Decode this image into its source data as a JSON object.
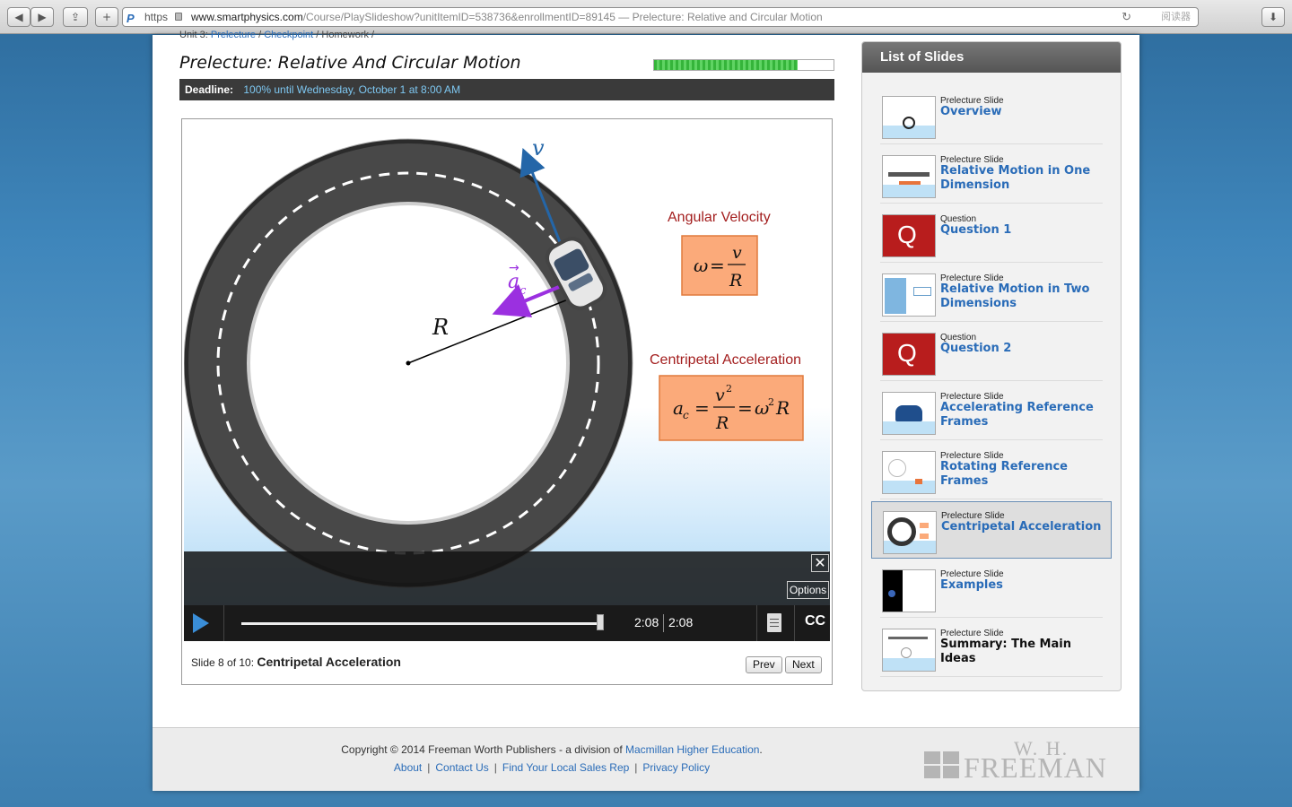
{
  "browser": {
    "protocol": "https",
    "url_host": "www.smartphysics.com",
    "url_path": "/Course/PlaySlideshow?unitItemID=538736&enrollmentID=89145",
    "page_title": "— Prelecture: Relative and Circular Motion",
    "reader_label": "阅读器"
  },
  "breadcrumb": {
    "unit": "Unit 3:",
    "prelecture": "Prelecture",
    "sep1": "/",
    "checkpoint": "Checkpoint",
    "sep2": "/",
    "homework": "Homework /"
  },
  "header": {
    "title": "Prelecture: Relative And Circular Motion",
    "progress": 0.8,
    "deadline_label": "Deadline:",
    "deadline_value": "100% until Wednesday, October 1 at 8:00 AM"
  },
  "slide": {
    "labels": {
      "v": "v",
      "R": "R",
      "ac": "a",
      "ac_sub": "c",
      "angular_velocity": "Angular Velocity",
      "centripetal_acceleration": "Centripetal Acceleration"
    },
    "player": {
      "close_label": "✕",
      "options_label": "Options",
      "current_time": "2:08",
      "total_time": "2:08",
      "progress": 1.0,
      "cc_label": "CC"
    },
    "caption_prefix": "Slide 8 of 10:",
    "caption_title": "Centripetal Acceleration",
    "prev_label": "Prev",
    "next_label": "Next"
  },
  "sidebar": {
    "heading": "List of Slides",
    "items": [
      {
        "type": "Prelecture Slide",
        "title": "Overview",
        "thumb": "overview"
      },
      {
        "type": "Prelecture Slide",
        "title": "Relative Motion in One Dimension",
        "thumb": "boat"
      },
      {
        "type": "Question",
        "title": "Question 1",
        "thumb": "question"
      },
      {
        "type": "Prelecture Slide",
        "title": "Relative Motion in Two Dimensions",
        "thumb": "river"
      },
      {
        "type": "Question",
        "title": "Question 2",
        "thumb": "question"
      },
      {
        "type": "Prelecture Slide",
        "title": "Accelerating Reference Frames",
        "thumb": "car"
      },
      {
        "type": "Prelecture Slide",
        "title": "Rotating Reference Frames",
        "thumb": "rotating"
      },
      {
        "type": "Prelecture Slide",
        "title": "Centripetal Acceleration",
        "thumb": "ring",
        "active": true
      },
      {
        "type": "Prelecture Slide",
        "title": "Examples",
        "thumb": "examples"
      },
      {
        "type": "Prelecture Slide",
        "title": "Summary: The Main Ideas",
        "thumb": "summary"
      }
    ]
  },
  "footer": {
    "copyright_text": "Copyright © 2014 Freeman Worth Publishers - a division of",
    "copyright_link": "Macmillan Higher Education",
    "copyright_end": ".",
    "links": [
      "About",
      "Contact Us",
      "Find Your Local Sales Rep",
      "Privacy Policy"
    ],
    "logo_top": "W. H.",
    "logo_name": "FREEMAN"
  },
  "colors": {
    "accent": "#2a6cb8",
    "formula_box": "#fbaa7a",
    "formula_text_red": "#a31e1e",
    "velocity_arrow": "#2466a8",
    "acceleration_arrow": "#9b30e0",
    "progress_green": "#35b43a"
  }
}
